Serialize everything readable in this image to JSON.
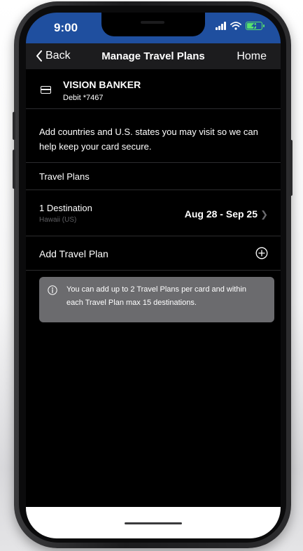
{
  "status_bar": {
    "time": "9:00",
    "color": "#1f4f9f"
  },
  "nav": {
    "back_label": "Back",
    "title": "Manage Travel Plans",
    "home_label": "Home"
  },
  "card": {
    "name": "VISION BANKER",
    "number": "Debit *7467"
  },
  "info_text": "Add countries and U.S. states you may visit so we can help keep your card secure.",
  "travel_plans": {
    "section_title": "Travel Plans",
    "plans": [
      {
        "destination_count": "1 Destination",
        "location": "Hawaii (US)",
        "dates": "Aug 28 - Sep 25"
      }
    ],
    "add_label": "Add Travel Plan"
  },
  "notice": {
    "text": "You can add up to 2 Travel Plans per card and within each Travel Plan max 15 destinations."
  },
  "icons": {
    "back": "chevron-left-icon",
    "card": "credit-card-icon",
    "chevron": "chevron-right-icon",
    "add": "plus-circle-icon",
    "info": "info-icon",
    "signal": "signal-icon",
    "wifi": "wifi-icon",
    "battery": "battery-charging-icon"
  },
  "colors": {
    "battery": "#57e36c",
    "notice_bg": "#6b6b6e",
    "screen_bg": "#000000"
  }
}
